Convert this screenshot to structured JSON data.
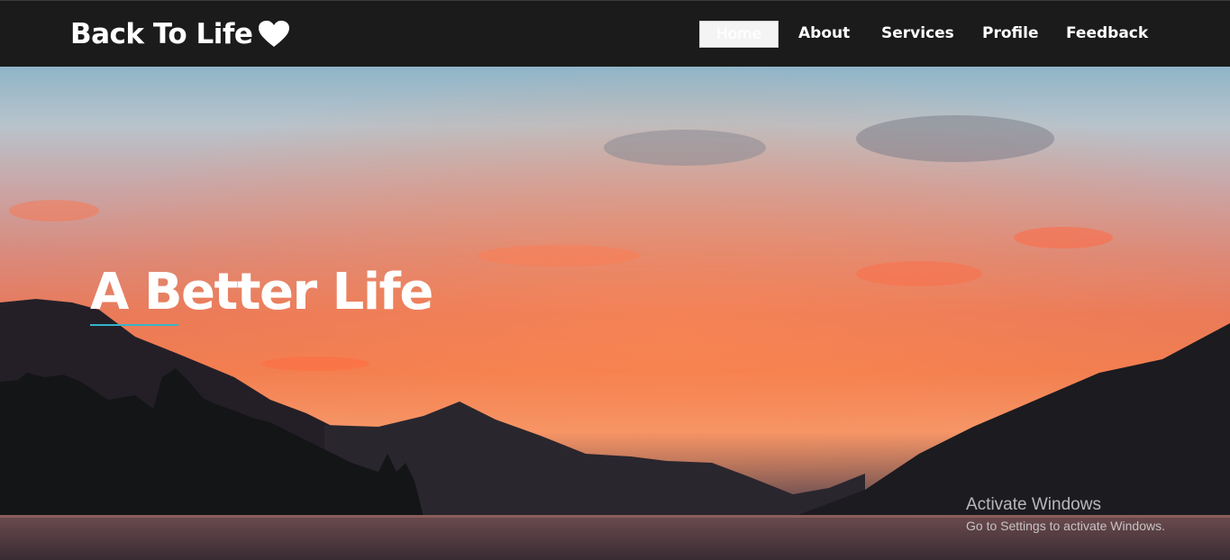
{
  "navbar": {
    "brand": {
      "title": "Back To Life",
      "icon": "heart-icon"
    },
    "links": [
      {
        "label": "Home",
        "active": true
      },
      {
        "label": "About",
        "active": false
      },
      {
        "label": "Services",
        "active": false
      },
      {
        "label": "Profile",
        "active": false
      },
      {
        "label": "Feedback",
        "active": false
      }
    ]
  },
  "hero": {
    "title": "A Better Life",
    "underline_color": "#34b4c9",
    "background": "sunset-over-lake-and-mountains"
  },
  "watermark": {
    "title": "Activate Windows",
    "subtitle": "Go to Settings to activate Windows."
  },
  "colors": {
    "navbar_bg": "#1b1b1b",
    "text": "#ffffff",
    "accent": "#34b4c9"
  }
}
